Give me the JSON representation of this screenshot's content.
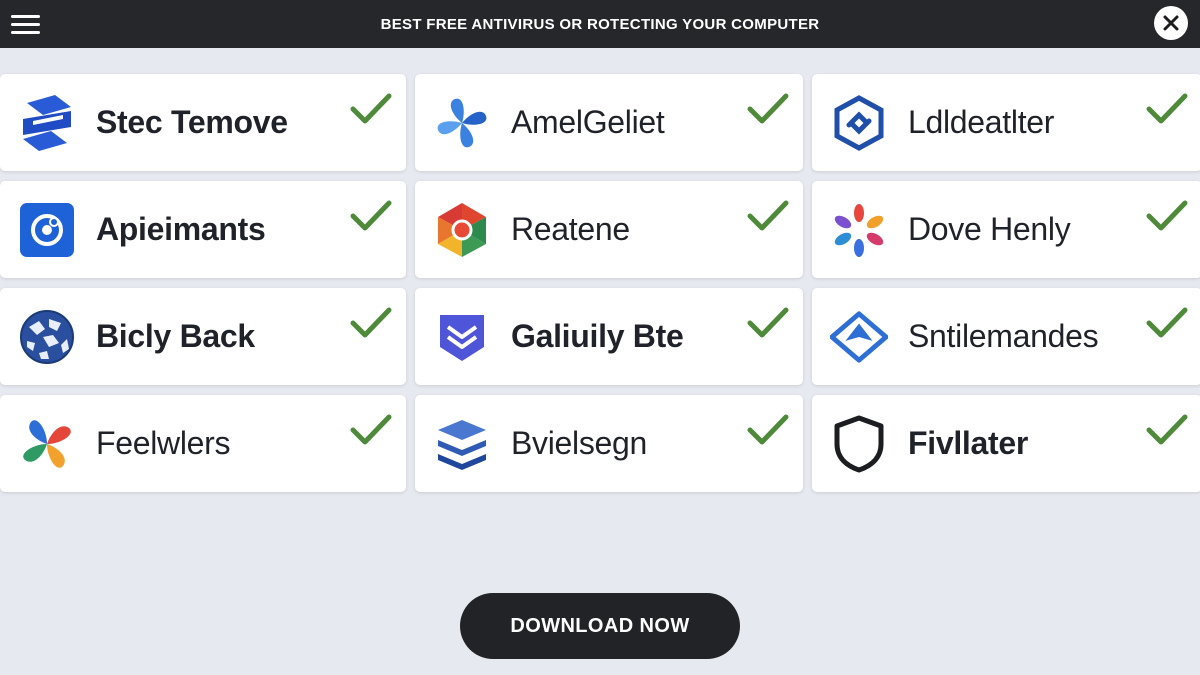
{
  "header": {
    "title": "BEST FREE ANTIVIRUS OR ROTECTING YOUR COMPUTER",
    "menu_icon": "hamburger-menu-icon",
    "close_icon": "close-icon"
  },
  "colors": {
    "header_bg": "#26272b",
    "page_bg": "#e6e9ef",
    "check": "#4e8a3a",
    "button_bg": "#222326"
  },
  "products": [
    {
      "name": "Stec Temove",
      "icon": "blue-s-shield-icon",
      "checked": true
    },
    {
      "name": "AmelGeliet",
      "icon": "blue-pinwheel-icon",
      "checked": true
    },
    {
      "name": "Ldldeatlter",
      "icon": "blue-hexagon-link-icon",
      "checked": true
    },
    {
      "name": "Apieimants",
      "icon": "blue-target-square-icon",
      "checked": true
    },
    {
      "name": "Reatene",
      "icon": "multicolor-hexagon-icon",
      "checked": true
    },
    {
      "name": "Dove Henly",
      "icon": "multicolor-petals-icon",
      "checked": true
    },
    {
      "name": "Bicly Back",
      "icon": "blue-globe-icon",
      "checked": true
    },
    {
      "name": "Galiuily Bte",
      "icon": "purple-chevron-shield-icon",
      "checked": true
    },
    {
      "name": "Sntilemandes",
      "icon": "blue-diamond-arrow-icon",
      "checked": true
    },
    {
      "name": "Feelwlers",
      "icon": "multicolor-flower-icon",
      "checked": true
    },
    {
      "name": "Bvielsegn",
      "icon": "blue-layers-icon",
      "checked": true
    },
    {
      "name": "Fivllater",
      "icon": "black-shield-icon",
      "checked": true
    }
  ],
  "footer": {
    "download_label": "DOWNLOAD NOW"
  }
}
